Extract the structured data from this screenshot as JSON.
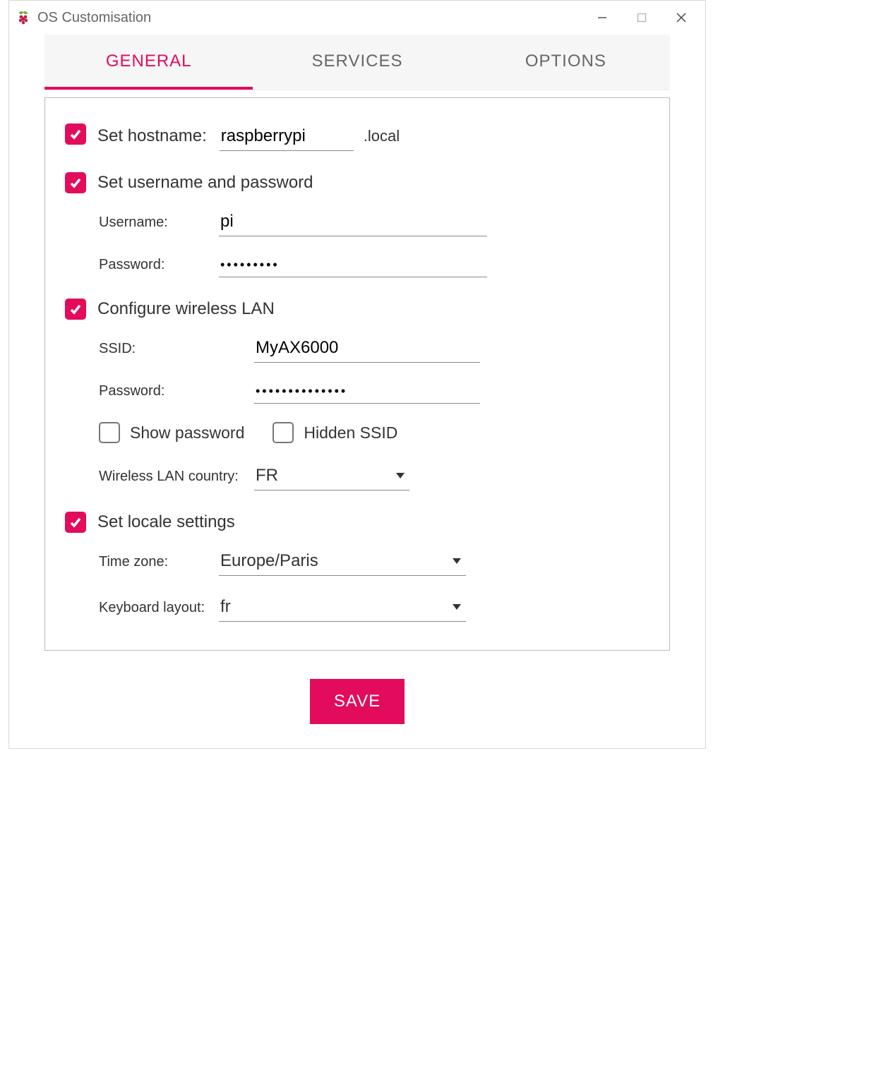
{
  "window": {
    "title": "OS Customisation"
  },
  "tabs": {
    "general": "GENERAL",
    "services": "SERVICES",
    "options": "OPTIONS"
  },
  "hostname": {
    "label": "Set hostname:",
    "value": "raspberrypi",
    "suffix": ".local",
    "checked": true
  },
  "userpass": {
    "label": "Set username and password",
    "checked": true,
    "username_label": "Username:",
    "username": "pi",
    "password_label": "Password:",
    "password": "•••••••••"
  },
  "wlan": {
    "label": "Configure wireless LAN",
    "checked": true,
    "ssid_label": "SSID:",
    "ssid": "MyAX6000",
    "password_label": "Password:",
    "password": "••••••••••••••",
    "show_password_label": "Show password",
    "show_password": false,
    "hidden_ssid_label": "Hidden SSID",
    "hidden_ssid": false,
    "country_label": "Wireless LAN country:",
    "country": "FR"
  },
  "locale": {
    "label": "Set locale settings",
    "checked": true,
    "tz_label": "Time zone:",
    "tz": "Europe/Paris",
    "kb_label": "Keyboard layout:",
    "kb": "fr"
  },
  "save_label": "SAVE"
}
